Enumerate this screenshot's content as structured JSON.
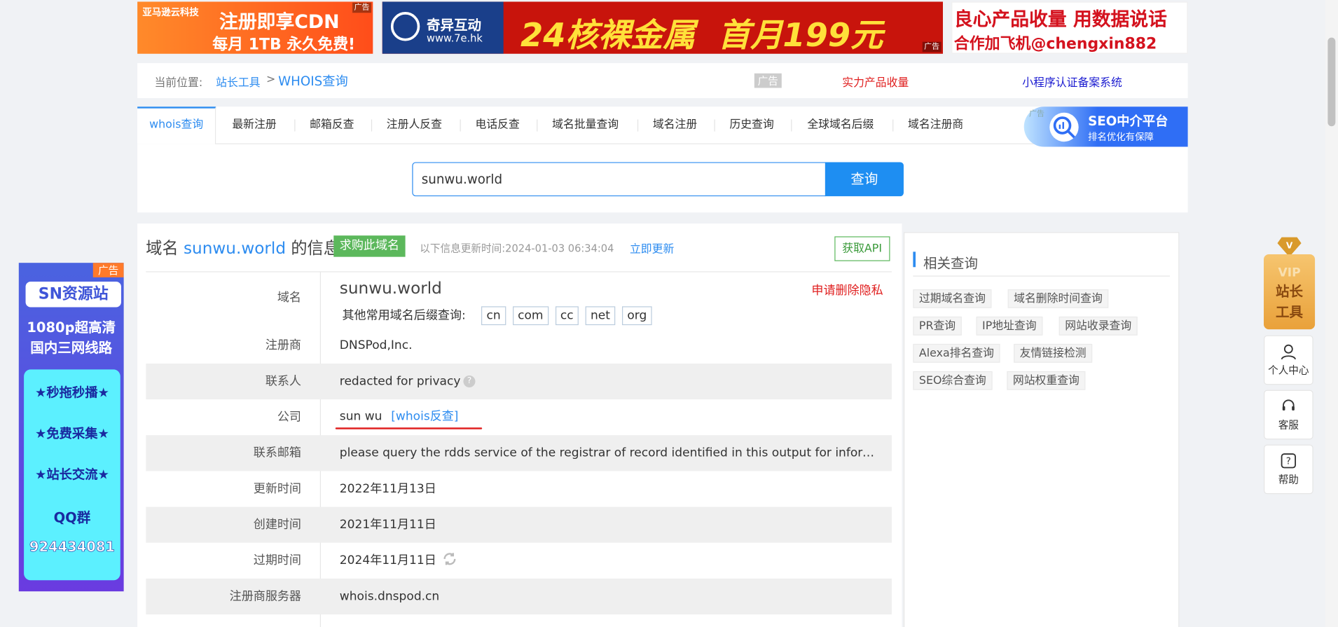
{
  "ads": {
    "banner1_brand": "亚马逊云科技",
    "banner1_line1": "注册即享CDN",
    "banner1_line2": "每月 1TB 永久免费!",
    "banner2_brand": "奇异互动",
    "banner2_url": "www.7e.hk",
    "banner2_line": "24核裸金属  首月199元",
    "banner3_line1": "良心产品收量 用数据说话",
    "banner3_line2": "合作加飞机@chengxin882",
    "ad_label": "广告",
    "seo_title": "SEO中介平台",
    "seo_sub": "排名优化有保障",
    "left_title": "SN资源站",
    "left_l1": "1080p超高清",
    "left_l2": "国内三网线路",
    "left_l3": "★秒拖秒播★",
    "left_l4": "★免费采集★",
    "left_l5": "★站长交流★",
    "left_l6": "QQ群",
    "left_l7": "924434081"
  },
  "breadcrumb": {
    "prefix": "当前位置:",
    "home": "站长工具",
    "sep": ">",
    "current": "WHOIS查询",
    "ad": "广告",
    "link1": "实力产品收量",
    "link2": "小程序认证备案系统"
  },
  "tabs": [
    "whois查询",
    "最新注册",
    "邮箱反查",
    "注册人反查",
    "电话反查",
    "域名批量查询",
    "域名注册",
    "历史查询",
    "全球域名后缀",
    "域名注册商"
  ],
  "search": {
    "value": "sunwu.world",
    "button": "查询"
  },
  "info": {
    "title_prefix": "域名",
    "domain": "sunwu.world",
    "title_suffix": "的信息",
    "buy_button": "求购此域名",
    "update_text": "以下信息更新时间:2024-01-03 06:34:04",
    "refresh_link": "立即更新",
    "api_button": "获取API",
    "delete_privacy": "申请删除隐私",
    "other_suffix_label": "其他常用域名后缀查询:",
    "suffixes": [
      "cn",
      "com",
      "cc",
      "net",
      "org"
    ],
    "whois_reverse": "[whois反查]"
  },
  "rows": [
    {
      "label": "域名",
      "value": "sunwu.world"
    },
    {
      "label": "注册商",
      "value": "DNSPod,Inc."
    },
    {
      "label": "联系人",
      "value": "redacted for privacy"
    },
    {
      "label": "公司",
      "value": "sun wu"
    },
    {
      "label": "联系邮箱",
      "value": "please query the rdds service of the registrar of record identified in this output for information on how to contact the registrant"
    },
    {
      "label": "更新时间",
      "value": "2022年11月13日"
    },
    {
      "label": "创建时间",
      "value": "2021年11月11日"
    },
    {
      "label": "过期时间",
      "value": "2024年11月11日"
    },
    {
      "label": "注册商服务器",
      "value": "whois.dnspod.cn"
    }
  ],
  "related": {
    "title": "相关查询",
    "items": [
      "过期域名查询",
      "域名删除时间查询",
      "PR查询",
      "IP地址查询",
      "网站收录查询",
      "Alexa排名查询",
      "友情链接检测",
      "SEO综合查询",
      "网站权重查询"
    ]
  },
  "right_float": {
    "vip1": "VIP",
    "vip2": "站长",
    "vip3": "工具",
    "personal": "个人中心",
    "service": "客服",
    "help": "帮助"
  },
  "colors": {
    "link_blue": "#2d8cf0",
    "search_blue": "#1e8ef2",
    "buy_green": "#5cb85c",
    "red": "#e02020"
  }
}
